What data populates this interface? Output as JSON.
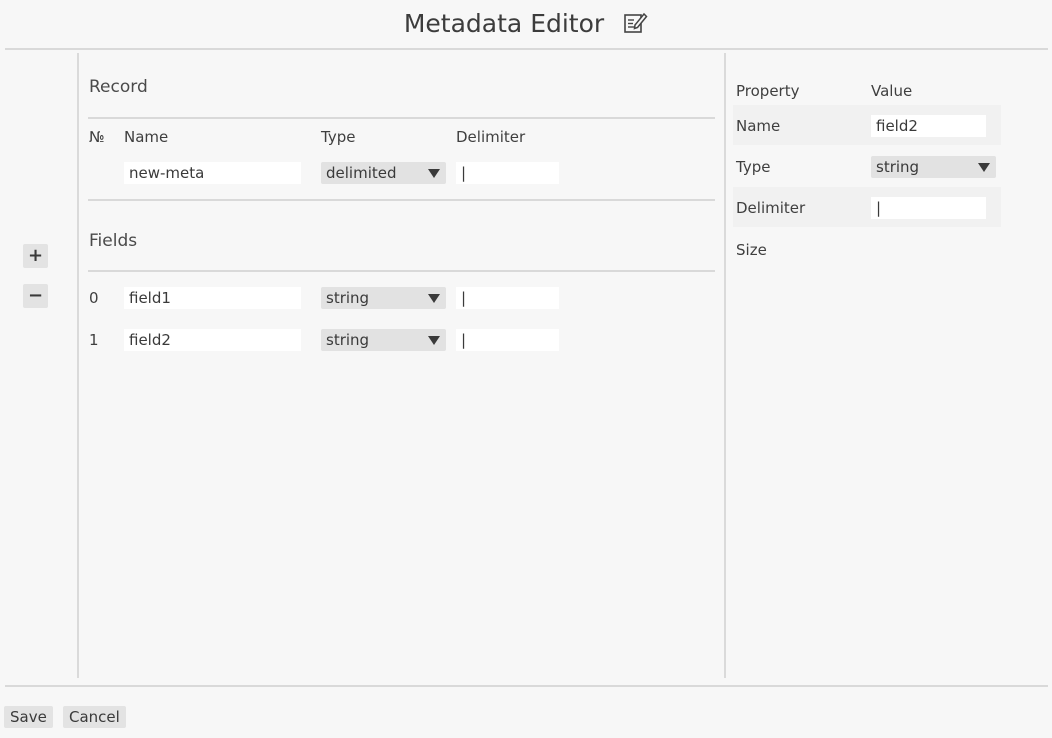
{
  "title": "Metadata Editor",
  "side_buttons": {
    "add": "+",
    "remove": "−"
  },
  "record": {
    "section_title": "Record",
    "headers": {
      "num": "№",
      "name": "Name",
      "type": "Type",
      "delimiter": "Delimiter"
    },
    "name_value": "new-meta",
    "type_value": "delimited",
    "delimiter_value": "|"
  },
  "fields": {
    "section_title": "Fields",
    "rows": [
      {
        "index": "0",
        "name": "field1",
        "type": "string",
        "delimiter": "|"
      },
      {
        "index": "1",
        "name": "field2",
        "type": "string",
        "delimiter": "|"
      }
    ]
  },
  "properties": {
    "header_property": "Property",
    "header_value": "Value",
    "rows": [
      {
        "label": "Name",
        "value": "field2"
      },
      {
        "label": "Type",
        "value": "string"
      },
      {
        "label": "Delimiter",
        "value": "|"
      },
      {
        "label": "Size",
        "value": ""
      }
    ]
  },
  "footer": {
    "save": "Save",
    "cancel": "Cancel"
  },
  "icons": {
    "title_icon": "edit-document-icon",
    "dropdown": "caret-down-icon"
  }
}
